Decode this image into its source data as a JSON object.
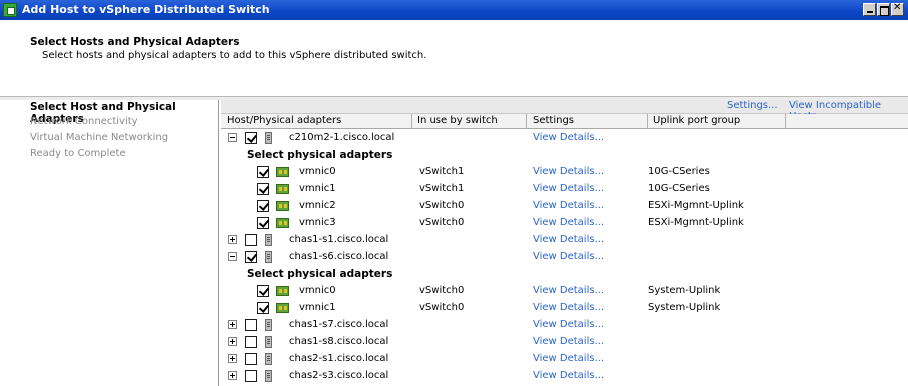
{
  "window": {
    "title": "Add Host to vSphere Distributed Switch"
  },
  "header": {
    "title": "Select Hosts and Physical Adapters",
    "subtitle": "Select hosts and physical adapters to add to this vSphere distributed switch."
  },
  "sidebar": {
    "items": [
      {
        "label": "Select Host and Physical Adapters",
        "active": true
      },
      {
        "label": "Network Connectivity",
        "active": false
      },
      {
        "label": "Virtual Machine Networking",
        "active": false
      },
      {
        "label": "Ready to Complete",
        "active": false
      }
    ]
  },
  "toolbar": {
    "settings_label": "Settings...",
    "incompatible_label": "View Incompatible Hosts..."
  },
  "columns": {
    "host": "Host/Physical adapters",
    "in_use": "In use by switch",
    "settings": "Settings",
    "uplink": "Uplink port group"
  },
  "rows": [
    {
      "kind": "host",
      "expanded": true,
      "checked": true,
      "name": "c210m2-1.cisco.local",
      "in_use": "",
      "settings": "View Details...",
      "uplink": ""
    },
    {
      "kind": "section",
      "label": "Select physical adapters"
    },
    {
      "kind": "nic",
      "checked": true,
      "name": "vmnic0",
      "in_use": "vSwitch1",
      "settings": "View Details...",
      "uplink": "10G-CSeries"
    },
    {
      "kind": "nic",
      "checked": true,
      "name": "vmnic1",
      "in_use": "vSwitch1",
      "settings": "View Details...",
      "uplink": "10G-CSeries"
    },
    {
      "kind": "nic",
      "checked": true,
      "name": "vmnic2",
      "in_use": "vSwitch0",
      "settings": "View Details...",
      "uplink": "ESXi-Mgmnt-Uplink"
    },
    {
      "kind": "nic",
      "checked": true,
      "name": "vmnic3",
      "in_use": "vSwitch0",
      "settings": "View Details...",
      "uplink": "ESXi-Mgmnt-Uplink"
    },
    {
      "kind": "host",
      "expanded": false,
      "checked": false,
      "name": "chas1-s1.cisco.local",
      "in_use": "",
      "settings": "View Details...",
      "uplink": ""
    },
    {
      "kind": "host",
      "expanded": true,
      "checked": true,
      "name": "chas1-s6.cisco.local",
      "in_use": "",
      "settings": "View Details...",
      "uplink": ""
    },
    {
      "kind": "section",
      "label": "Select physical adapters"
    },
    {
      "kind": "nic",
      "checked": true,
      "name": "vmnic0",
      "in_use": "vSwitch0",
      "settings": "View Details...",
      "uplink": "System-Uplink"
    },
    {
      "kind": "nic",
      "checked": true,
      "name": "vmnic1",
      "in_use": "vSwitch0",
      "settings": "View Details...",
      "uplink": "System-Uplink"
    },
    {
      "kind": "host",
      "expanded": false,
      "checked": false,
      "name": "chas1-s7.cisco.local",
      "in_use": "",
      "settings": "View Details...",
      "uplink": ""
    },
    {
      "kind": "host",
      "expanded": false,
      "checked": false,
      "name": "chas1-s8.cisco.local",
      "in_use": "",
      "settings": "View Details...",
      "uplink": ""
    },
    {
      "kind": "host",
      "expanded": false,
      "checked": false,
      "name": "chas2-s1.cisco.local",
      "in_use": "",
      "settings": "View Details...",
      "uplink": ""
    },
    {
      "kind": "host",
      "expanded": false,
      "checked": false,
      "name": "chas2-s3.cisco.local",
      "in_use": "",
      "settings": "View Details...",
      "uplink": ""
    }
  ],
  "colors": {
    "titlebar": "#0b46c7",
    "link": "#2b63c9",
    "muted": "#8a8a8a"
  }
}
